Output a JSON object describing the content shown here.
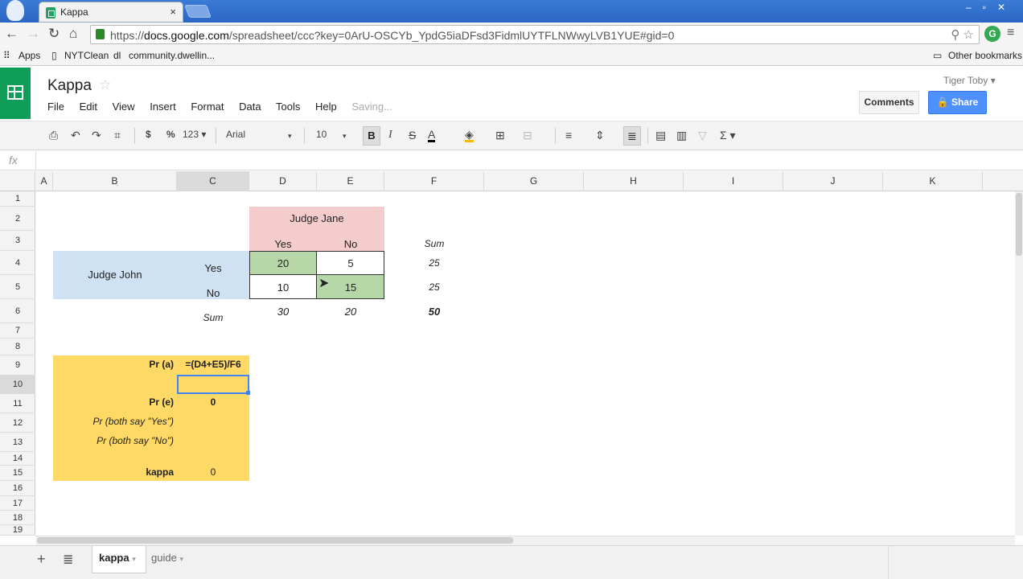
{
  "browser": {
    "tab_title": "Kappa",
    "url_scheme": "https://",
    "url_host": "docs.google.com",
    "url_path": "/spreadsheet/ccc?key=0ArU-OSCYb_YpdG5iaDFsd3FidmlUYTFLNWwyLVB1YUE#gid=0",
    "bookmarks": [
      "Apps",
      "NYTClean",
      "community.dwellin..."
    ],
    "other_bookmarks": "Other bookmarks"
  },
  "doc": {
    "title": "Kappa",
    "menu": [
      "File",
      "Edit",
      "View",
      "Insert",
      "Format",
      "Data",
      "Tools",
      "Help"
    ],
    "status": "Saving...",
    "user": "Tiger Toby",
    "comments_label": "Comments",
    "share_label": "Share"
  },
  "toolbar": {
    "currency": "$",
    "percent": "%",
    "number_format": "123",
    "font": "Arial",
    "font_size": "10",
    "bold": "B",
    "italic": "I",
    "strike": "S",
    "text_color": "A",
    "sum": "Σ"
  },
  "formula_bar": {
    "fx": "fx",
    "value": ""
  },
  "columns": [
    "A",
    "B",
    "C",
    "D",
    "E",
    "F",
    "G",
    "H",
    "I",
    "J",
    "K"
  ],
  "rows": [
    "1",
    "2",
    "3",
    "4",
    "5",
    "6",
    "7",
    "8",
    "9",
    "10",
    "11",
    "12",
    "13",
    "14",
    "15",
    "16",
    "17",
    "18",
    "19"
  ],
  "sheet": {
    "judge_jane": "Judge Jane",
    "judge_john": "Judge John",
    "yes": "Yes",
    "no": "No",
    "sum": "Sum",
    "d4": "20",
    "e4": "5",
    "f4": "25",
    "d5": "10",
    "e5": "15",
    "f5": "25",
    "d6": "30",
    "e6": "20",
    "f6": "50",
    "pr_a_label": "Pr (a)",
    "pr_a_formula": "=(D4+E5)/F6",
    "pr_e_label": "Pr (e)",
    "pr_e_value": "0",
    "pr_yes_label": "Pr (both say \"Yes\")",
    "pr_no_label": "Pr (both say \"No\")",
    "kappa_label": "kappa",
    "kappa_value": "0"
  },
  "sheet_tabs": [
    "kappa",
    "guide"
  ],
  "colors": {
    "pink": "#f4cccc",
    "blue": "#cfe2f3",
    "green": "#b6d7a8",
    "yellow": "#ffd966",
    "select": "#4285f4"
  }
}
